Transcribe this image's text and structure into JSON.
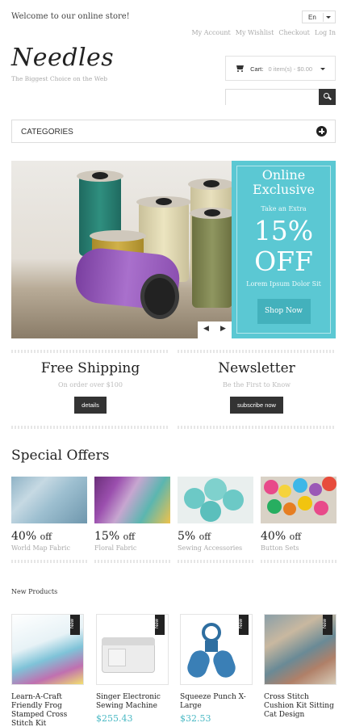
{
  "header": {
    "welcome": "Welcome to our online store!",
    "language": "En",
    "links": [
      "My Account",
      "My Wishlist",
      "Checkout",
      "Log In"
    ],
    "logo": "Needles",
    "tagline": "The Biggest Choice on the Web",
    "cart_label": "Cart:",
    "cart_items": "0 item(s) - $0.00",
    "search_placeholder": ""
  },
  "categories_label": "CATEGORIES",
  "promo": {
    "line1": "Online",
    "line2": "Exclusive",
    "take": "Take an Extra",
    "percent": "15%",
    "off": "OFF",
    "lorem": "Lorem Ipsum Dolor Sit",
    "button": "Shop Now"
  },
  "slider": {
    "prev": "◀",
    "next": "▶"
  },
  "info": {
    "shipping": {
      "title": "Free Shipping",
      "sub": "On order over $100",
      "button": "details"
    },
    "newsletter": {
      "title": "Newsletter",
      "sub": "Be the First to Know",
      "button": "subscribe now"
    }
  },
  "special_offers": {
    "title": "Special Offers",
    "items": [
      {
        "percent": "40%",
        "off": "off",
        "label": "World Map Fabric"
      },
      {
        "percent": "15%",
        "off": "off",
        "label": "Floral Fabric"
      },
      {
        "percent": "5%",
        "off": "off",
        "label": "Sewing Accessories"
      },
      {
        "percent": "40%",
        "off": "off",
        "label": "Button Sets"
      }
    ]
  },
  "new_products": {
    "title": "New Products",
    "badge": "New",
    "items": [
      {
        "name": "Learn-A-Craft Friendly Frog Stamped Cross Stitch Kit",
        "price": ""
      },
      {
        "name": "Singer Electronic Sewing Machine",
        "price": "$255.43"
      },
      {
        "name": "Squeeze Punch X-Large",
        "price": "$32.53"
      },
      {
        "name": "Cross Stitch Cushion Kit Sitting Cat Design",
        "price": ""
      }
    ]
  },
  "colors": {
    "accent": "#5bc8d3",
    "dark": "#333333",
    "price": "#4ab9c4"
  }
}
